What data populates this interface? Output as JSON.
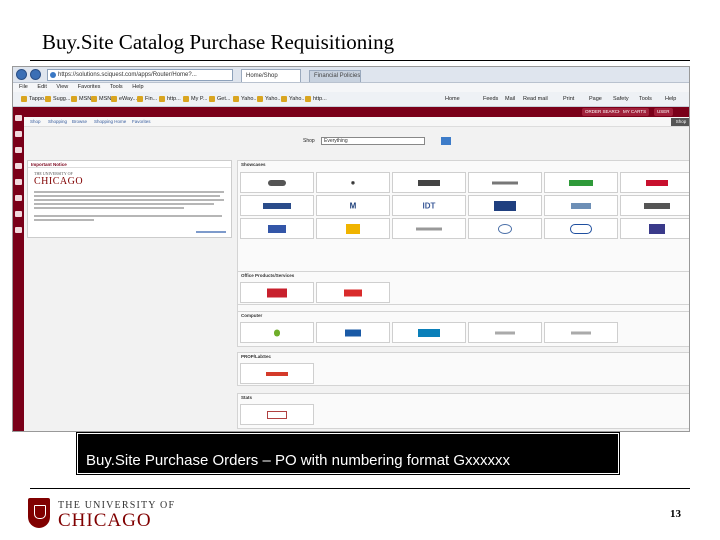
{
  "slide": {
    "title": "Buy.Site Catalog Purchase Requisitioning",
    "caption": "Buy.Site Purchase Orders – PO with numbering format Gxxxxxx",
    "page_number": "13",
    "logo_line1": "THE UNIVERSITY OF",
    "logo_line2": "CHICAGO"
  },
  "browser": {
    "url": "https://solutions.sciquest.com/apps/Router/Home?...",
    "tab_active": "Home/Shop",
    "tab_inactive": "Financial Policies",
    "menu": [
      "File",
      "Edit",
      "View",
      "Favorites",
      "Tools",
      "Help"
    ],
    "favorites": [
      "Tappo...",
      "Sugg...",
      "MSN",
      "MSN",
      "eWay...",
      "Fin...",
      "http...",
      "My P...",
      "Get...",
      "Yaho...",
      "Yaho...",
      "Yaho...",
      "http..."
    ],
    "commands": [
      "Home",
      "Feeds",
      "Mail",
      "Read mail",
      "Print",
      "Page",
      "Safety",
      "Tools",
      "Help"
    ]
  },
  "app": {
    "top_buttons": [
      "ORDER SEARCH",
      "MY CARTS",
      "USER"
    ],
    "subnav": [
      "Shop",
      "Shopping",
      "Browse",
      "Shopping Home",
      "Favorites"
    ],
    "go_label": "Shop",
    "search_label": "Shop",
    "search_value": "Everything",
    "announcement_title": "Important Notice",
    "announcement_logo_1": "THE UNIVERSITY OF",
    "announcement_logo_2": "CHICAGO"
  },
  "sections": [
    {
      "title": "Showcases",
      "rows": 3
    },
    {
      "title": "Office Products/Services"
    },
    {
      "title": "Computer"
    },
    {
      "title": "PROP/LabSec"
    },
    {
      "title": "Stats"
    }
  ],
  "colors": {
    "maroon": "#7a0019",
    "caption_bg": "#000000",
    "link": "#365c9e"
  }
}
